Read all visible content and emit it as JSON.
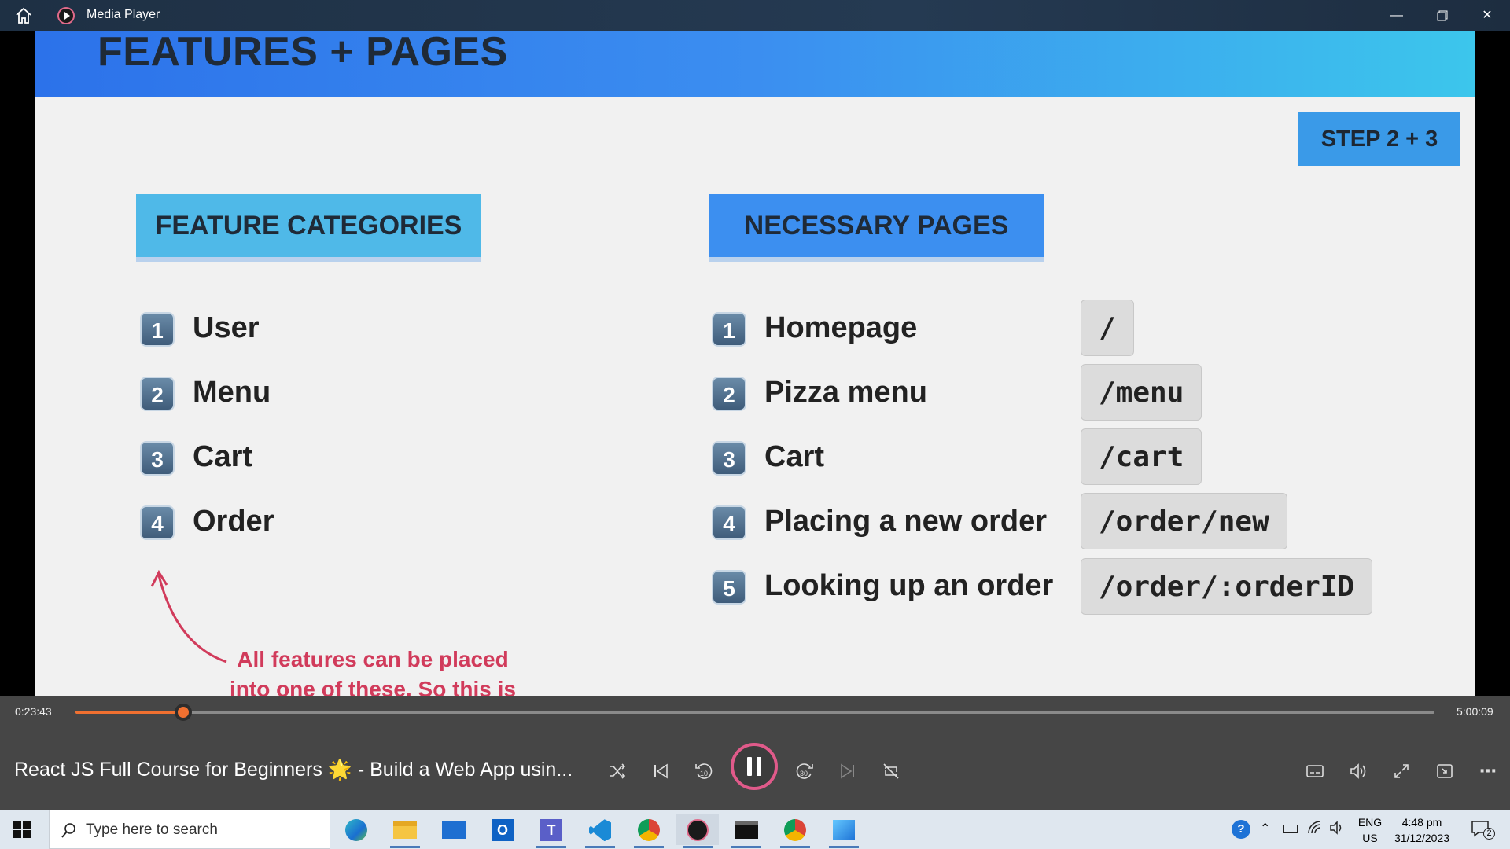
{
  "window": {
    "title": "Media Player"
  },
  "slide": {
    "heading": "FEATURES + PAGES",
    "step": "STEP 2 + 3",
    "features_header": "FEATURE CATEGORIES",
    "pages_header": "NECESSARY PAGES",
    "features": [
      {
        "num": "1",
        "label": "User"
      },
      {
        "num": "2",
        "label": "Menu"
      },
      {
        "num": "3",
        "label": "Cart"
      },
      {
        "num": "4",
        "label": "Order"
      }
    ],
    "pages": [
      {
        "num": "1",
        "label": "Homepage",
        "route": "/"
      },
      {
        "num": "2",
        "label": "Pizza menu",
        "route": "/menu"
      },
      {
        "num": "3",
        "label": "Cart",
        "route": "/cart"
      },
      {
        "num": "4",
        "label": "Placing a new order",
        "route": "/order/new"
      },
      {
        "num": "5",
        "label": "Looking up an order",
        "route": "/order/:orderID"
      }
    ],
    "note": "All features can be placed into one of these. So this is what the app will essentially be about"
  },
  "player": {
    "elapsed": "0:23:43",
    "duration": "5:00:09",
    "progress_fraction": 0.079,
    "video_title": "React JS Full Course for Beginners 🌟 - Build a Web App usin..."
  },
  "taskbar": {
    "search_placeholder": "Type here to search",
    "lang_top": "ENG",
    "lang_bottom": "US",
    "time": "4:48 pm",
    "date": "31/12/2023",
    "notification_count": "2"
  },
  "icons": [
    "home-icon",
    "media-player-logo-icon",
    "minimize-icon",
    "restore-icon",
    "close-icon",
    "shuffle-icon",
    "previous-icon",
    "skip-back-10-icon",
    "pause-icon",
    "skip-forward-30-icon",
    "next-icon",
    "repeat-icon",
    "subtitles-icon",
    "volume-icon",
    "fullscreen-icon",
    "mini-view-icon",
    "more-icon",
    "windows-start-icon",
    "search-icon"
  ],
  "colors": {
    "accent": "#f07030",
    "note": "#d13b5b",
    "banner_start": "#2c72ea",
    "banner_end": "#3cc6ec"
  }
}
